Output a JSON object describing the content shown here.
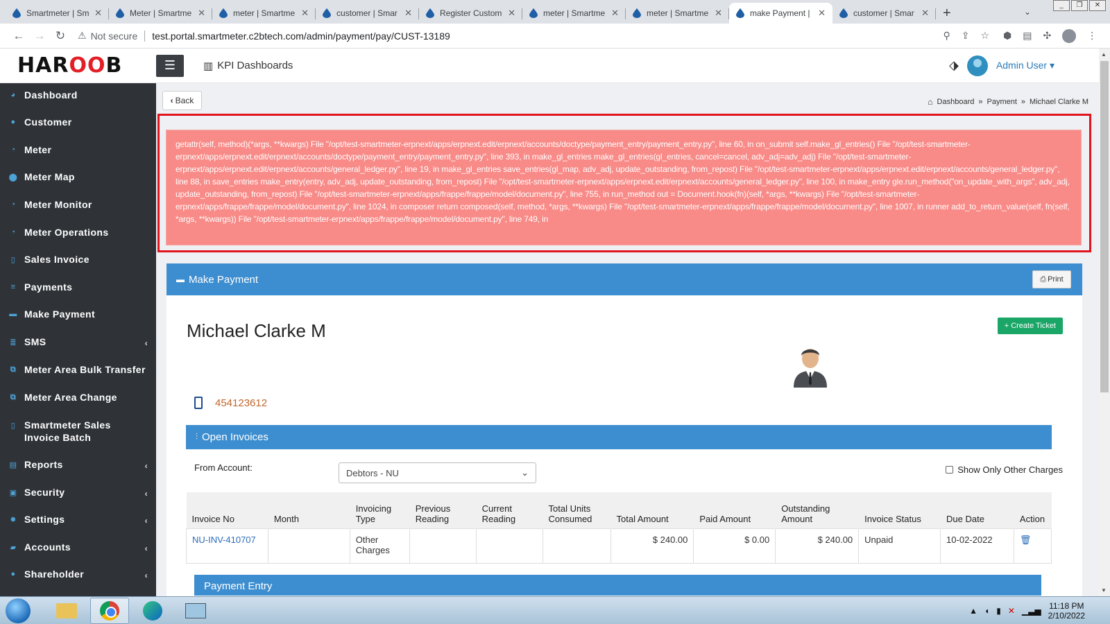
{
  "browser": {
    "tabs": [
      {
        "title": "Smartmeter | Sm",
        "active": false
      },
      {
        "title": "Meter | Smartme",
        "active": false
      },
      {
        "title": "meter | Smartme",
        "active": false
      },
      {
        "title": "customer | Smar",
        "active": false
      },
      {
        "title": "Register Custom",
        "active": false
      },
      {
        "title": "meter | Smartme",
        "active": false
      },
      {
        "title": "meter | Smartme",
        "active": false
      },
      {
        "title": "make Payment |",
        "active": true
      },
      {
        "title": "customer | Smar",
        "active": false
      }
    ],
    "security_label": "Not secure",
    "url": "test.portal.smartmeter.c2btech.com/admin/payment/pay/CUST-13189"
  },
  "header": {
    "logo_prefix": "HAR",
    "logo_accent": "OO",
    "logo_suffix": "B",
    "kpi_label": "KPI Dashboards",
    "user_label": "Admin User ▾"
  },
  "sidebar": {
    "items": [
      {
        "label": "Dashboard",
        "icon": "dashboard-icon",
        "glyph": "◕",
        "arrow": false
      },
      {
        "label": "Customer",
        "icon": "user-icon",
        "glyph": "●",
        "arrow": false
      },
      {
        "label": "Meter",
        "icon": "gauge-icon",
        "glyph": "◔",
        "arrow": false
      },
      {
        "label": "Meter Map",
        "icon": "map-pin-icon",
        "glyph": "⬤",
        "arrow": false
      },
      {
        "label": "Meter Monitor",
        "icon": "gauge-icon",
        "glyph": "◔",
        "arrow": false
      },
      {
        "label": "Meter Operations",
        "icon": "gauge-icon",
        "glyph": "◔",
        "arrow": false
      },
      {
        "label": "Sales Invoice",
        "icon": "file-icon",
        "glyph": "▯",
        "arrow": false
      },
      {
        "label": "Payments",
        "icon": "list-icon",
        "glyph": "≡",
        "arrow": false
      },
      {
        "label": "Make Payment",
        "icon": "credit-card-icon",
        "glyph": "▬",
        "arrow": false
      },
      {
        "label": "SMS",
        "icon": "sms-icon",
        "glyph": "≣",
        "arrow": true
      },
      {
        "label": "Meter Area Bulk Transfer",
        "icon": "external-link-icon",
        "glyph": "⧉",
        "arrow": false
      },
      {
        "label": "Meter Area Change",
        "icon": "external-link-icon",
        "glyph": "⧉",
        "arrow": false
      },
      {
        "label": "Smartmeter Sales Invoice Batch",
        "icon": "file-icon",
        "glyph": "▯",
        "arrow": false
      },
      {
        "label": "Reports",
        "icon": "report-icon",
        "glyph": "▤",
        "arrow": true
      },
      {
        "label": "Security",
        "icon": "lock-icon",
        "glyph": "▣",
        "arrow": true
      },
      {
        "label": "Settings",
        "icon": "gear-icon",
        "glyph": "✹",
        "arrow": true
      },
      {
        "label": "Accounts",
        "icon": "bank-icon",
        "glyph": "▰",
        "arrow": true
      },
      {
        "label": "Shareholder",
        "icon": "user-icon",
        "glyph": "●",
        "arrow": true
      }
    ]
  },
  "main": {
    "back_label": "Back",
    "breadcrumb": [
      "Dashboard",
      "Payment",
      "Michael Clarke M"
    ],
    "error_text": "getattr(self, method)(*args, **kwargs) File \"/opt/test-smartmeter-erpnext/apps/erpnext.edit/erpnext/accounts/doctype/payment_entry/payment_entry.py\", line 60, in on_submit self.make_gl_entries() File \"/opt/test-smartmeter-erpnext/apps/erpnext.edit/erpnext/accounts/doctype/payment_entry/payment_entry.py\", line 393, in make_gl_entries make_gl_entries(gl_entries, cancel=cancel, adv_adj=adv_adj) File \"/opt/test-smartmeter-erpnext/apps/erpnext.edit/erpnext/accounts/general_ledger.py\", line 19, in make_gl_entries save_entries(gl_map, adv_adj, update_outstanding, from_repost) File \"/opt/test-smartmeter-erpnext/apps/erpnext.edit/erpnext/accounts/general_ledger.py\", line 88, in save_entries make_entry(entry, adv_adj, update_outstanding, from_repost) File \"/opt/test-smartmeter-erpnext/apps/erpnext.edit/erpnext/accounts/general_ledger.py\", line 100, in make_entry gle.run_method(\"on_update_with_args\", adv_adj, update_outstanding, from_repost) File \"/opt/test-smartmeter-erpnext/apps/frappe/frappe/model/document.py\", line 755, in run_method out = Document.hook(fn)(self, *args, **kwargs) File \"/opt/test-smartmeter-erpnext/apps/frappe/frappe/model/document.py\", line 1024, in composer return composed(self, method, *args, **kwargs) File \"/opt/test-smartmeter-erpnext/apps/frappe/frappe/model/document.py\", line 1007, in runner add_to_return_value(self, fn(self, *args, **kwargs)) File \"/opt/test-smartmeter-erpnext/apps/frappe/frappe/model/document.py\", line 749, in",
    "panel_title": "Make Payment",
    "print_label": "Print",
    "customer_name": "Michael Clarke M",
    "create_ticket_label": "Create Ticket",
    "phone": "454123612",
    "open_invoices_title": "Open Invoices",
    "from_account_label": "From Account:",
    "from_account_value": "Debtors - NU",
    "show_other_label": "Show Only Other Charges",
    "invoice_columns": [
      "Invoice No",
      "Month",
      "Invoicing Type",
      "Previous Reading",
      "Current Reading",
      "Total Units Consumed",
      "Total Amount",
      "Paid Amount",
      "Outstanding Amount",
      "Invoice Status",
      "Due Date",
      "Action"
    ],
    "invoices": [
      {
        "invoice_no": "NU-INV-410707",
        "month": "",
        "type": "Other Charges",
        "prev": "",
        "curr": "",
        "units": "",
        "total": "$ 240.00",
        "paid": "$ 0.00",
        "outstanding": "$ 240.00",
        "status": "Unpaid",
        "due": "10-02-2022"
      }
    ],
    "payment_entry_title": "Payment Entry"
  },
  "taskbar": {
    "time": "11:18 PM",
    "date": "2/10/2022"
  },
  "colors": {
    "sidebar_bg": "#2f3338",
    "panel_blue": "#3d8ed0",
    "error_bg": "#f88a87",
    "error_outline": "#e0141d",
    "ticket_green": "#1aa667",
    "phone_orange": "#c4652a"
  }
}
